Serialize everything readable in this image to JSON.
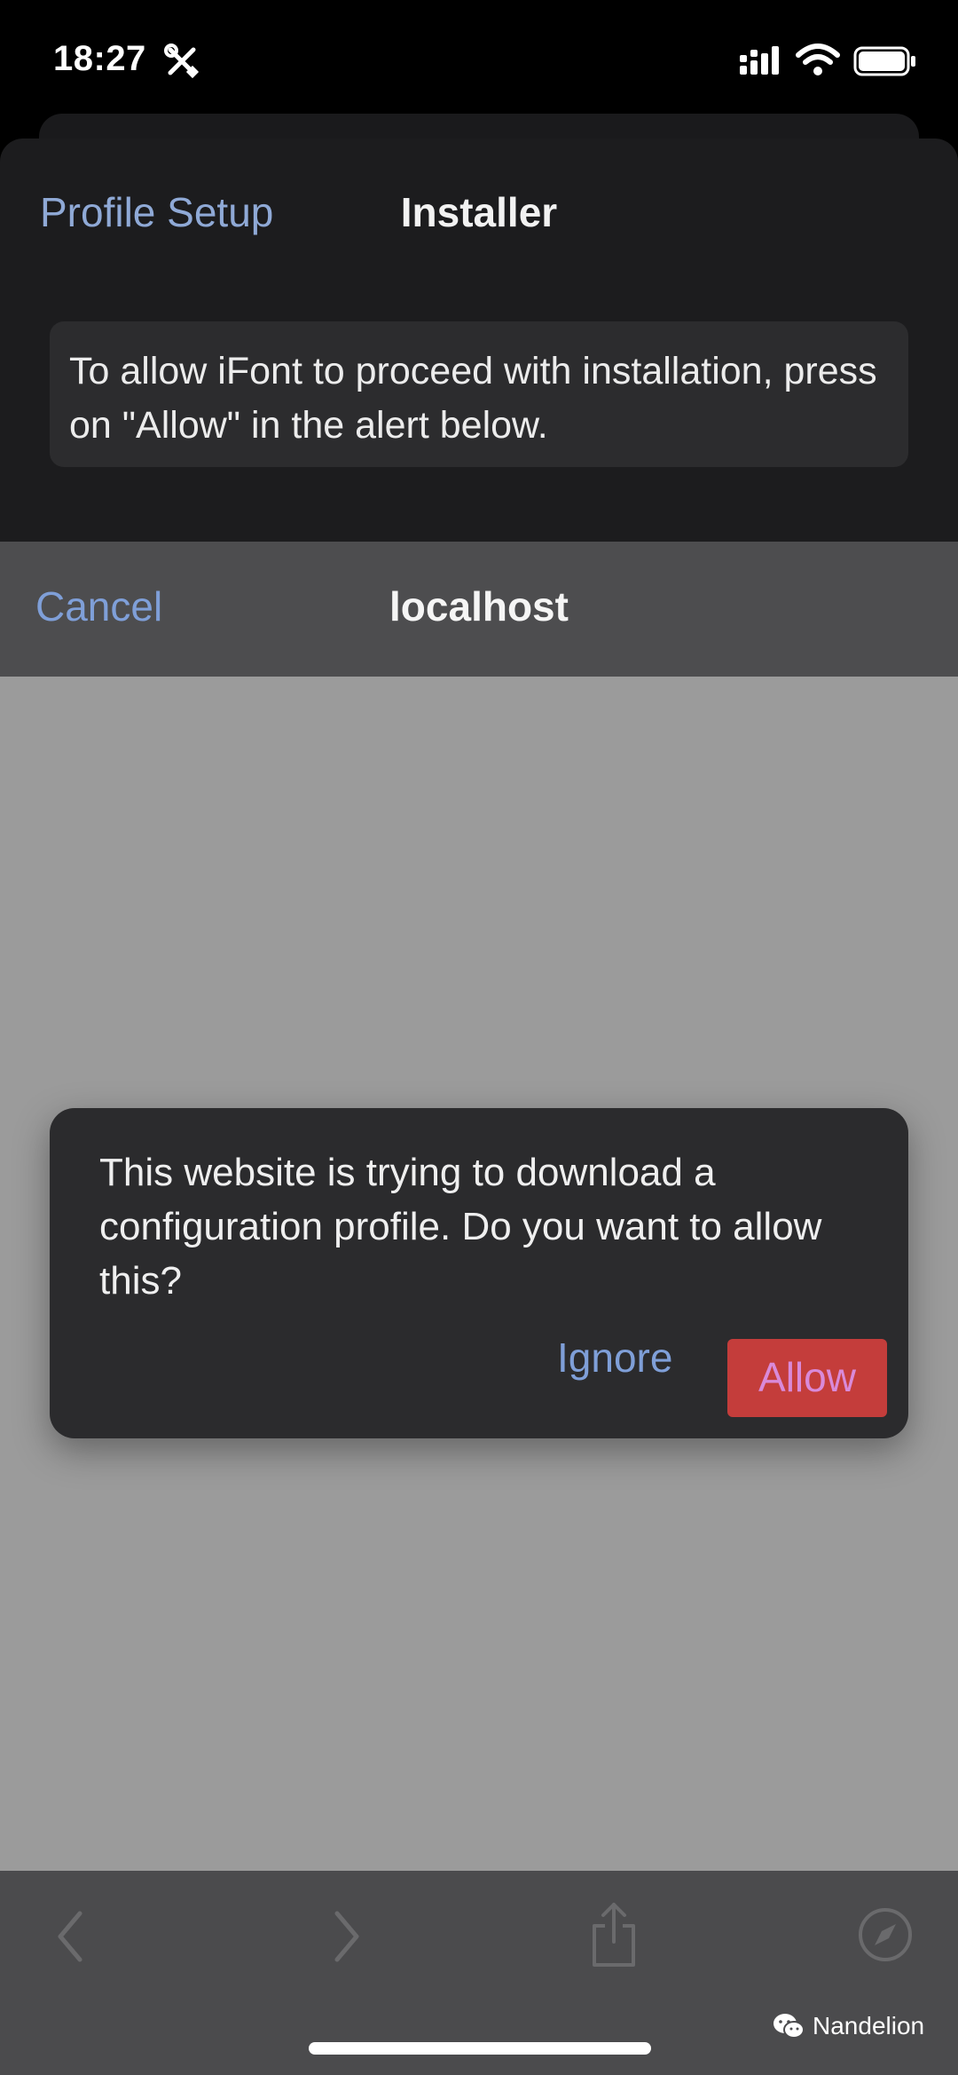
{
  "status_bar": {
    "time": "18:27"
  },
  "app_sheet": {
    "back_label": "Profile Setup",
    "title": "Installer",
    "info_text": "To allow iFont to proceed with installation, press on \"Allow\" in the alert below."
  },
  "browser": {
    "cancel_label": "Cancel",
    "title": "localhost"
  },
  "alert": {
    "message": "This website is trying to download a configuration profile. Do you want to allow this?",
    "ignore_label": "Ignore",
    "allow_label": "Allow"
  },
  "watermark": {
    "text": "Nandelion"
  },
  "colors": {
    "link_blue": "#7f9fd8",
    "allow_red": "#c43d3b",
    "allow_text": "#d98ad9",
    "sheet_dark": "#1c1c1e",
    "overlay_gray": "#9b9b9b"
  },
  "icons": {
    "status": [
      "tools-icon",
      "signal-icon",
      "wifi-icon",
      "battery-icon"
    ],
    "toolbar": [
      "back-icon",
      "forward-icon",
      "share-icon",
      "compass-icon"
    ],
    "watermark": "wechat-icon"
  }
}
